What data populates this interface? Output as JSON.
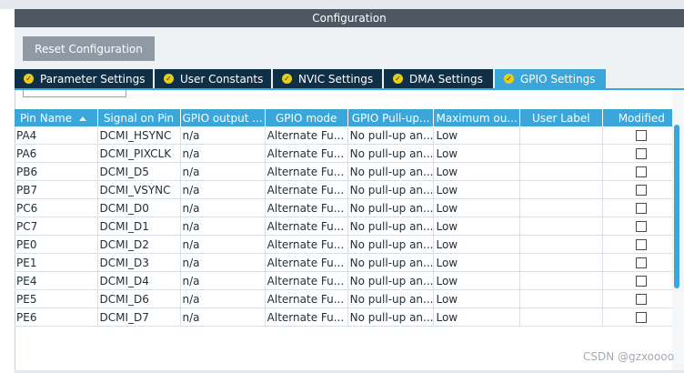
{
  "header": {
    "title": "Configuration"
  },
  "toolbar": {
    "reset_label": "Reset Configuration"
  },
  "tabs": [
    {
      "label": "Parameter Settings",
      "active": false
    },
    {
      "label": "User Constants",
      "active": false
    },
    {
      "label": "NVIC Settings",
      "active": false
    },
    {
      "label": "DMA Settings",
      "active": false
    },
    {
      "label": "GPIO Settings",
      "active": true
    }
  ],
  "table": {
    "columns": [
      "Pin Name",
      "Signal on Pin",
      "GPIO output ...",
      "GPIO mode",
      "GPIO Pull-up...",
      "Maximum ou...",
      "User Label",
      "Modified"
    ],
    "sorted_column": "Pin Name",
    "rows": [
      {
        "pin": "PA4",
        "signal": "DCMI_HSYNC",
        "output": "n/a",
        "mode": "Alternate Fu...",
        "pull": "No pull-up an...",
        "speed": "Low",
        "label": "",
        "modified": false
      },
      {
        "pin": "PA6",
        "signal": "DCMI_PIXCLK",
        "output": "n/a",
        "mode": "Alternate Fu...",
        "pull": "No pull-up an...",
        "speed": "Low",
        "label": "",
        "modified": false
      },
      {
        "pin": "PB6",
        "signal": "DCMI_D5",
        "output": "n/a",
        "mode": "Alternate Fu...",
        "pull": "No pull-up an...",
        "speed": "Low",
        "label": "",
        "modified": false
      },
      {
        "pin": "PB7",
        "signal": "DCMI_VSYNC",
        "output": "n/a",
        "mode": "Alternate Fu...",
        "pull": "No pull-up an...",
        "speed": "Low",
        "label": "",
        "modified": false
      },
      {
        "pin": "PC6",
        "signal": "DCMI_D0",
        "output": "n/a",
        "mode": "Alternate Fu...",
        "pull": "No pull-up an...",
        "speed": "Low",
        "label": "",
        "modified": false
      },
      {
        "pin": "PC7",
        "signal": "DCMI_D1",
        "output": "n/a",
        "mode": "Alternate Fu...",
        "pull": "No pull-up an...",
        "speed": "Low",
        "label": "",
        "modified": false
      },
      {
        "pin": "PE0",
        "signal": "DCMI_D2",
        "output": "n/a",
        "mode": "Alternate Fu...",
        "pull": "No pull-up an...",
        "speed": "Low",
        "label": "",
        "modified": false
      },
      {
        "pin": "PE1",
        "signal": "DCMI_D3",
        "output": "n/a",
        "mode": "Alternate Fu...",
        "pull": "No pull-up an...",
        "speed": "Low",
        "label": "",
        "modified": false
      },
      {
        "pin": "PE4",
        "signal": "DCMI_D4",
        "output": "n/a",
        "mode": "Alternate Fu...",
        "pull": "No pull-up an...",
        "speed": "Low",
        "label": "",
        "modified": false
      },
      {
        "pin": "PE5",
        "signal": "DCMI_D6",
        "output": "n/a",
        "mode": "Alternate Fu...",
        "pull": "No pull-up an...",
        "speed": "Low",
        "label": "",
        "modified": false
      },
      {
        "pin": "PE6",
        "signal": "DCMI_D7",
        "output": "n/a",
        "mode": "Alternate Fu...",
        "pull": "No pull-up an...",
        "speed": "Low",
        "label": "",
        "modified": false
      }
    ]
  },
  "watermark": "CSDN @gzxoooo",
  "icons": {
    "tab_status": "check-circle-icon",
    "sort": "sort-ascending-icon",
    "modified": "checkbox"
  },
  "colors": {
    "header_bg": "#4d5862",
    "tab_bg": "#0f2f47",
    "tab_active_bg": "#3aa6d9",
    "table_header_bg": "#3aa6d9",
    "status_yellow": "#e8cd1c",
    "button_bg": "#8f9aa4"
  }
}
